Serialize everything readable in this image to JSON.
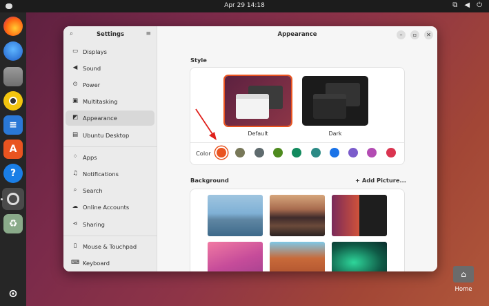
{
  "topbar": {
    "clock": "Apr 29  14:18",
    "network_icon": "network-icon",
    "volume_icon": "volume-icon",
    "power_icon": "power-icon"
  },
  "dock": {
    "apps": [
      "firefox",
      "thunderbird",
      "files",
      "rhythmbox",
      "libreoffice-writer",
      "app-center",
      "help",
      "settings",
      "trash"
    ],
    "show_apps_icon": "apps-grid-icon"
  },
  "settings": {
    "sidebar_title": "Settings",
    "sidebar_items": [
      {
        "label": "Displays",
        "icon": "display-icon"
      },
      {
        "label": "Sound",
        "icon": "speaker-icon"
      },
      {
        "label": "Power",
        "icon": "power-icon"
      },
      {
        "label": "Multitasking",
        "icon": "multitasking-icon"
      },
      {
        "label": "Appearance",
        "icon": "appearance-icon",
        "active": true
      },
      {
        "label": "Ubuntu Desktop",
        "icon": "ubuntu-desktop-icon"
      },
      {
        "label": "Apps",
        "icon": "apps-icon"
      },
      {
        "label": "Notifications",
        "icon": "bell-icon"
      },
      {
        "label": "Search",
        "icon": "search-icon"
      },
      {
        "label": "Online Accounts",
        "icon": "cloud-icon"
      },
      {
        "label": "Sharing",
        "icon": "share-icon"
      },
      {
        "label": "Mouse & Touchpad",
        "icon": "mouse-icon"
      },
      {
        "label": "Keyboard",
        "icon": "keyboard-icon"
      }
    ],
    "page_title": "Appearance",
    "style_label": "Style",
    "styles": [
      {
        "label": "Default",
        "selected": true
      },
      {
        "label": "Dark",
        "selected": false
      }
    ],
    "color_label": "Color",
    "colors": [
      "#e95420",
      "#787859",
      "#5f6b6e",
      "#4e8a1e",
      "#128a5e",
      "#2b8a85",
      "#1a73e8",
      "#7b5ccb",
      "#b34cb3",
      "#da3450"
    ],
    "selected_color": "#e95420",
    "background_label": "Background",
    "add_picture_label": "+ Add Picture..."
  },
  "desktop": {
    "home_label": "Home"
  }
}
